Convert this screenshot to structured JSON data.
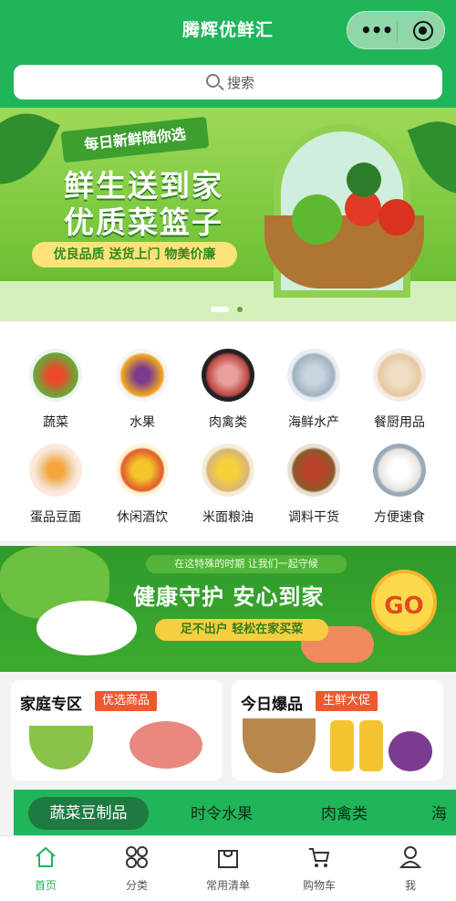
{
  "app": {
    "title": "腾辉优鲜汇"
  },
  "search": {
    "placeholder": "搜索"
  },
  "banner": {
    "ribbon": "每日新鲜随你选",
    "headline_1": "鲜生送到家",
    "headline_2": "优质菜篮子",
    "tagline": "优良品质 送货上门 物美价廉",
    "carousel": {
      "current": 1,
      "total": 2
    }
  },
  "categories": [
    {
      "label": "蔬菜",
      "icon": "vegetables-icon"
    },
    {
      "label": "水果",
      "icon": "fruits-icon"
    },
    {
      "label": "肉禽类",
      "icon": "meat-icon"
    },
    {
      "label": "海鲜水产",
      "icon": "seafood-icon"
    },
    {
      "label": "餐厨用品",
      "icon": "kitchenware-icon"
    },
    {
      "label": "蛋品豆面",
      "icon": "eggs-icon"
    },
    {
      "label": "休闲酒饮",
      "icon": "drinks-icon"
    },
    {
      "label": "米面粮油",
      "icon": "grain-oil-icon"
    },
    {
      "label": "调料干货",
      "icon": "spices-icon"
    },
    {
      "label": "方便速食",
      "icon": "instant-food-icon"
    }
  ],
  "promo": {
    "top_text": "在这特殊的时期  让我们一起守候",
    "headline": "健康守护 安心到家",
    "sub": "足不出户  轻松在家买菜",
    "go": "GO"
  },
  "sections": [
    {
      "title": "家庭专区",
      "tag": "优选商品"
    },
    {
      "title": "今日爆品",
      "tag": "生鲜大促"
    }
  ],
  "tabs": [
    {
      "label": "蔬菜豆制品",
      "active": true
    },
    {
      "label": "时令水果",
      "active": false
    },
    {
      "label": "肉禽类",
      "active": false
    },
    {
      "label": "海",
      "active": false
    }
  ],
  "nav": [
    {
      "label": "首页",
      "icon": "home-icon",
      "active": true
    },
    {
      "label": "分类",
      "icon": "category-icon",
      "active": false
    },
    {
      "label": "常用清单",
      "icon": "shopping-bag-icon",
      "active": false
    },
    {
      "label": "购物车",
      "icon": "cart-icon",
      "active": false
    },
    {
      "label": "我",
      "icon": "user-icon",
      "active": false
    }
  ],
  "colors": {
    "primary": "#21b55a",
    "accent": "#f0582d",
    "nav_active": "#21b55a"
  }
}
